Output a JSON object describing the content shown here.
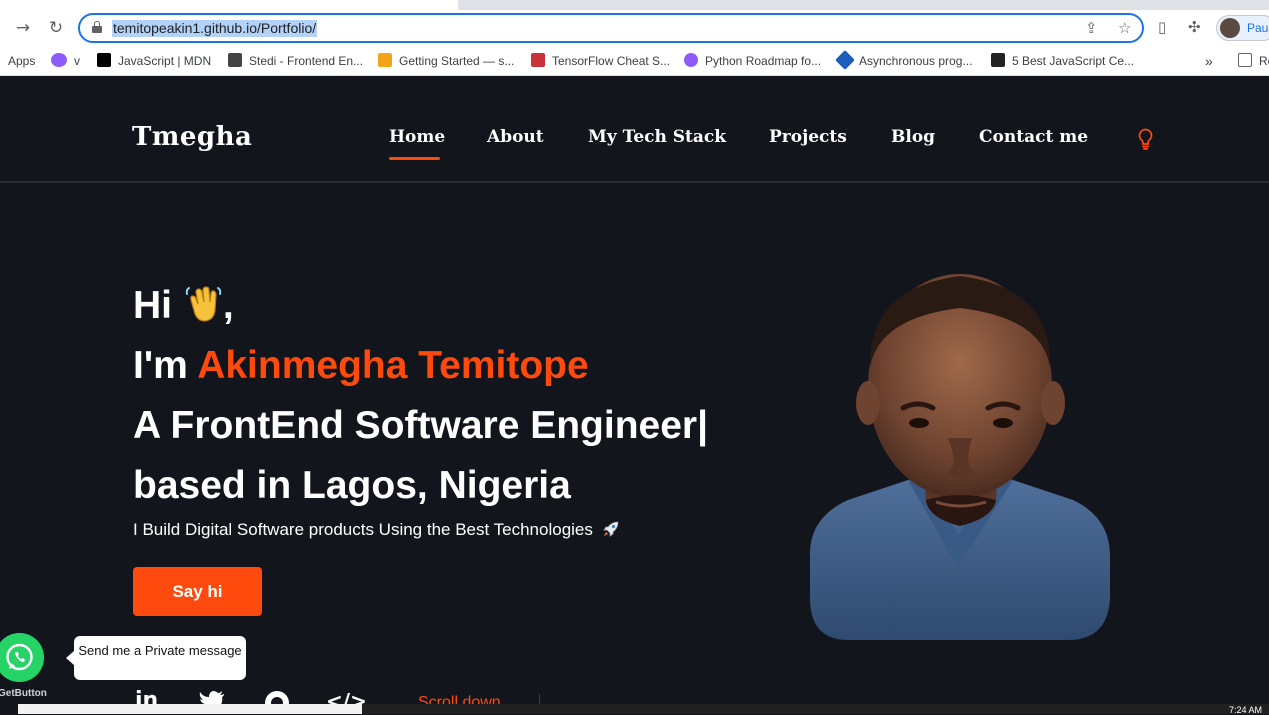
{
  "browser": {
    "url": "temitopeakin1.github.io/Portfolio/",
    "profile_name": "Paus",
    "bookmarks": [
      {
        "label": "Apps",
        "color": "#4285f4"
      },
      {
        "label": "v",
        "color": "#8e5cf7"
      },
      {
        "label": "JavaScript | MDN",
        "color": "#000000"
      },
      {
        "label": "Stedi - Frontend En...",
        "color": "#444444"
      },
      {
        "label": "Getting Started — s...",
        "color": "#f4a41b"
      },
      {
        "label": "TensorFlow Cheat S...",
        "color": "#c8333a"
      },
      {
        "label": "Python Roadmap fo...",
        "color": "#8e5cf7"
      },
      {
        "label": "Asynchronous prog...",
        "color": "#1b5ebe"
      },
      {
        "label": "5 Best JavaScript Ce...",
        "color": "#222222"
      }
    ],
    "bookmarks_overflow": "»",
    "reading_list": "Re"
  },
  "site": {
    "logo": "Tmegha",
    "nav": {
      "home": "Home",
      "about": "About",
      "tech": "My Tech Stack",
      "projects": "Projects",
      "blog": "Blog",
      "contact": "Contact me"
    },
    "hero": {
      "greeting": "Hi",
      "greeting_end": ",",
      "im": "I'm ",
      "name": "Akinmegha Temitope",
      "role": "A FrontEnd Software Engineer|",
      "location": "based in Lagos, Nigeria",
      "tagline": "I Build Digital Software products Using the Best Technologies",
      "cta": "Say hi"
    },
    "whatsapp": {
      "bubble": "Send me a Private message",
      "widget_label": "GetButton"
    },
    "scroll_down": "Scroll down"
  },
  "system": {
    "clock": "7:24 AM"
  },
  "colors": {
    "accent": "#ff4a0d",
    "background": "#13151c"
  }
}
